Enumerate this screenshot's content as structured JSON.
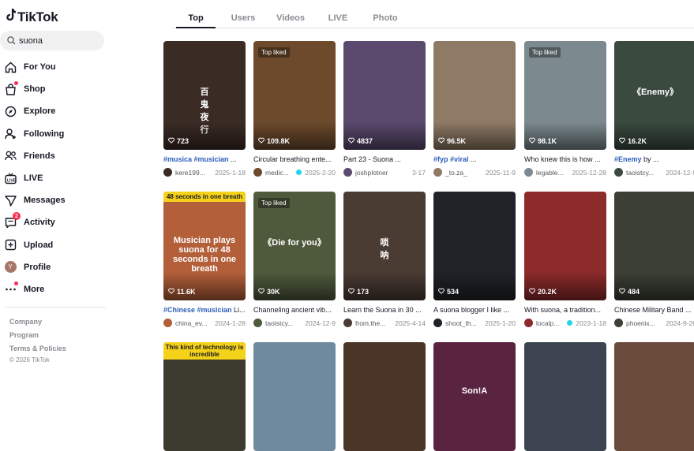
{
  "app": {
    "logo_text": "TikTok"
  },
  "search": {
    "value": "suona"
  },
  "nav": [
    {
      "label": "For You",
      "icon": "home-icon"
    },
    {
      "label": "Shop",
      "icon": "shop-icon"
    },
    {
      "label": "Explore",
      "icon": "compass-icon"
    },
    {
      "label": "Following",
      "icon": "following-icon"
    },
    {
      "label": "Friends",
      "icon": "friends-icon"
    },
    {
      "label": "LIVE",
      "icon": "live-icon"
    },
    {
      "label": "Messages",
      "icon": "messages-icon"
    },
    {
      "label": "Activity",
      "icon": "activity-icon",
      "badge": "2"
    },
    {
      "label": "Upload",
      "icon": "upload-icon"
    },
    {
      "label": "Profile",
      "icon": "avatar",
      "avatar_letter": "Y"
    },
    {
      "label": "More",
      "icon": "more-icon"
    }
  ],
  "footer": {
    "company": "Company",
    "program": "Program",
    "terms": "Terms & Policies",
    "copyright": "© 2026 TikTok"
  },
  "tabs": [
    "Top",
    "Users",
    "Videos",
    "LIVE",
    "Photo"
  ],
  "videos": [
    {
      "likes": "723",
      "hashtag": "#musica #musician",
      "rest": " ...",
      "author": "kere199...",
      "date": "2025-1-18",
      "thumb_text": "百\n鬼\n夜\n行",
      "bg": "#3b2b25"
    },
    {
      "likes": "109.8K",
      "hashtag": "",
      "rest": "Circular breathing ente...",
      "author": "medic...",
      "date": "2025-2-20",
      "verified": true,
      "top_liked": "Top liked",
      "bg": "#6d4a2c"
    },
    {
      "likes": "4837",
      "hashtag": "",
      "rest": "Part 23 - Suona ...",
      "author": "joshplotner",
      "date": "3-17",
      "bg": "#5b4a6e"
    },
    {
      "likes": "96.5K",
      "hashtag": "#fyp #viral",
      "rest": " ...",
      "author": "_to.za_",
      "date": "2025-11-9",
      "bg": "#8f7a66"
    },
    {
      "likes": "98.1K",
      "hashtag": "",
      "rest": "Who knew this is how ...",
      "author": "legable...",
      "date": "2025-12-28",
      "top_liked": "Top liked",
      "bg": "#7c8a8f"
    },
    {
      "likes": "16.2K",
      "hashtag": "#Enemy",
      "rest": " by ...",
      "author": "taoistcy...",
      "date": "2024-12-9",
      "thumb_text": "《Enemy》",
      "bg": "#3a4a3f"
    },
    {
      "likes": "11.6K",
      "hashtag": "#Chinese #musician",
      "rest": " Li...",
      "author": "china_ev...",
      "date": "2024-1-28",
      "thumb_text": "Musician plays suona for 48 seconds in one breath",
      "banner": "48 seconds in one breath",
      "bg": "#b35f3a"
    },
    {
      "likes": "30K",
      "hashtag": "",
      "rest": "Channeling ancient vib...",
      "author": "taoistcy...",
      "date": "2024-12-9",
      "top_liked": "Top liked",
      "thumb_text": "《Die for you》",
      "bg": "#4f5a3c"
    },
    {
      "likes": "173",
      "hashtag": "",
      "rest": "Learn the Suona in 30 ...",
      "author": "from.the...",
      "date": "2025-4-14",
      "thumb_text": "唢\n呐",
      "bg": "#4a3b33"
    },
    {
      "likes": "534",
      "hashtag": "",
      "rest": "A suona blogger I like ...",
      "author": "shoot_th...",
      "date": "2025-1-20",
      "bg": "#1f2227"
    },
    {
      "likes": "20.2K",
      "hashtag": "",
      "rest": "With suona, a tradition...",
      "author": "localp...",
      "date": "2023-1-18",
      "verified": true,
      "bg": "#8d2a2a"
    },
    {
      "likes": "484",
      "hashtag": "",
      "rest": "Chinese Military Band ...",
      "author": "phoenix...",
      "date": "2024-9-26",
      "bg": "#3b3f35"
    },
    {
      "likes": "",
      "hashtag": "",
      "rest": "",
      "author": "",
      "date": "",
      "banner": "This kind of technology is incredible",
      "bg": "#3d3a30"
    },
    {
      "likes": "",
      "hashtag": "",
      "rest": "",
      "author": "",
      "date": "",
      "bg": "#6f8a9e"
    },
    {
      "likes": "",
      "hashtag": "",
      "rest": "",
      "author": "",
      "date": "",
      "bg": "#4a3526"
    },
    {
      "likes": "",
      "hashtag": "",
      "rest": "",
      "author": "",
      "date": "",
      "thumb_text": "Son!A",
      "bg": "#5a2340"
    },
    {
      "likes": "",
      "hashtag": "",
      "rest": "",
      "author": "",
      "date": "",
      "bg": "#3b4450"
    },
    {
      "likes": "",
      "hashtag": "",
      "rest": "",
      "author": "",
      "date": "",
      "bg": "#6a4a3a"
    }
  ]
}
